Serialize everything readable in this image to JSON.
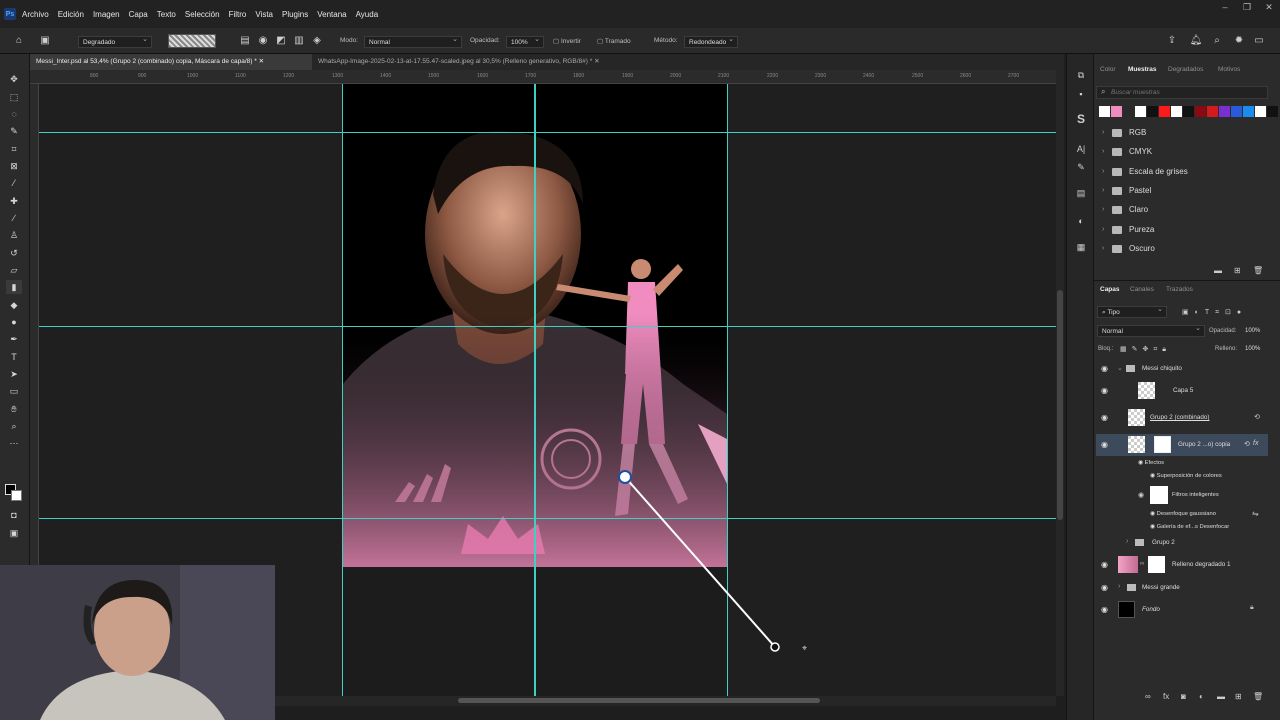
{
  "app": {
    "logo": "Ps"
  },
  "menu": [
    "Archivo",
    "Edición",
    "Imagen",
    "Capa",
    "Texto",
    "Selección",
    "Filtro",
    "Vista",
    "Plugins",
    "Ventana",
    "Ayuda"
  ],
  "options": {
    "gradient_type": "Degradado",
    "mode_label": "Modo:",
    "mode_value": "Normal",
    "opacity_label": "Opacidad:",
    "opacity_value": "100%",
    "invert_label": "Invertir",
    "dither_label": "Tramado",
    "method_label": "Método:",
    "method_value": "Redondeado"
  },
  "tabs": [
    {
      "label": "Messi_Inter.psd al 53,4% (Grupo 2 (combinado) copia, Máscara de capa/8) *",
      "active": true
    },
    {
      "label": "WhatsApp-Image-2025-02-13-at-17.55.47-scaled.jpeg al 30,5% (Relleno generativo, RGB/8#) *",
      "active": false
    }
  ],
  "ruler_ticks": [
    "800",
    "900",
    "1000",
    "1100",
    "1200",
    "1300",
    "1400",
    "1500",
    "1600",
    "1700",
    "1800",
    "1900",
    "2000",
    "2100",
    "2200",
    "2300",
    "2400",
    "2500",
    "2600",
    "2700"
  ],
  "swatches_panel": {
    "tabs": [
      "Color",
      "Muestras",
      "Degradados",
      "Motivos"
    ],
    "active_tab": "Muestras",
    "search_placeholder": "Buscar muestras",
    "colors": [
      "#ffffff",
      "#f08cc0",
      "#2a2a2a",
      "#ffffff",
      "#111111",
      "#ff1a1a",
      "#ffffff",
      "#111111",
      "#8a0a14",
      "#d41a1a",
      "#7a2fd0",
      "#2a5ad8",
      "#1a8cf0",
      "#ffffff",
      "#111111"
    ],
    "folders": [
      "RGB",
      "CMYK",
      "Escala de grises",
      "Pastel",
      "Claro",
      "Pureza",
      "Oscuro"
    ]
  },
  "layers_panel": {
    "tabs": [
      "Capas",
      "Canales",
      "Trazados"
    ],
    "active_tab": "Capas",
    "filter_value": "Tipo",
    "blend_mode": "Normal",
    "opacity_label": "Opacidad:",
    "opacity_value": "100%",
    "lock_label": "Bloq.:",
    "fill_label": "Relleno:",
    "fill_value": "100%",
    "layers": [
      {
        "name": "Messi chiquito"
      },
      {
        "name": "Capa 5"
      },
      {
        "name": "Grupo 2 (combinado)"
      },
      {
        "name": "Grupo 2 ...o) copia"
      },
      {
        "name": "Grupo 2"
      },
      {
        "name": "Relleno degradado 1"
      },
      {
        "name": "Messi grande"
      },
      {
        "name": "Fondo"
      }
    ],
    "effects_label": "Efectos",
    "color_overlay": "Superposición de colores",
    "smart_filters": "Filtros inteligentes",
    "gaussian_blur": "Desenfoque gaussiano",
    "blur_gallery": "Galería de ef...s Desenfocar"
  }
}
